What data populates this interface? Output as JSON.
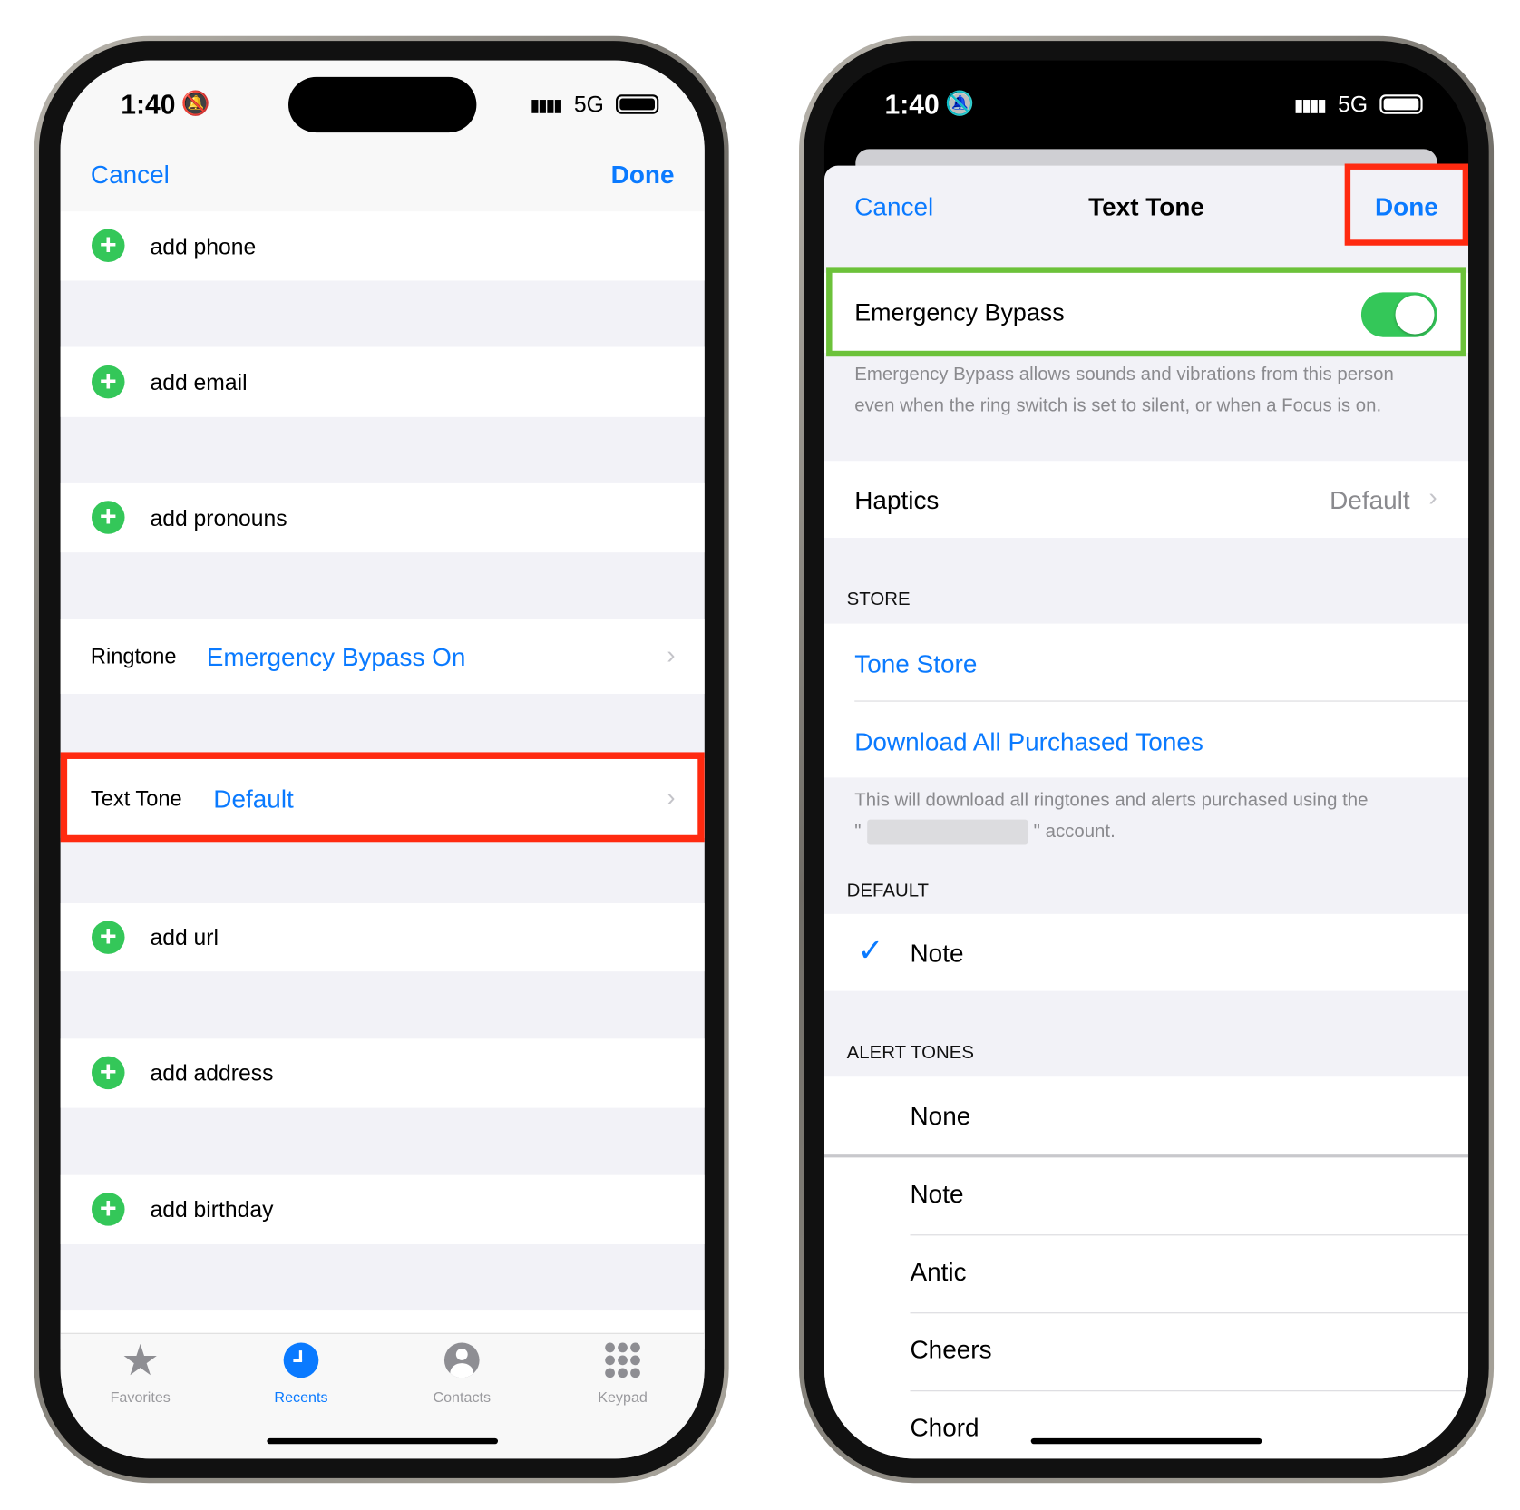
{
  "left": {
    "status": {
      "time": "1:40",
      "network": "5G"
    },
    "nav": {
      "cancel": "Cancel",
      "done": "Done"
    },
    "rows": {
      "phone": "add phone",
      "email": "add email",
      "pronouns": "add pronouns",
      "url": "add url",
      "address": "add address",
      "birthday": "add birthday"
    },
    "ringtone": {
      "label": "Ringtone",
      "value": "Emergency Bypass On"
    },
    "text_tone": {
      "label": "Text Tone",
      "value": "Default"
    },
    "tabs": [
      {
        "label": "Favorites",
        "icon": "star-icon"
      },
      {
        "label": "Recents",
        "icon": "clock-icon",
        "active": true
      },
      {
        "label": "Contacts",
        "icon": "person-circle-icon"
      },
      {
        "label": "Keypad",
        "icon": "keypad-icon"
      }
    ]
  },
  "right": {
    "status": {
      "time": "1:40",
      "network": "5G"
    },
    "nav": {
      "cancel": "Cancel",
      "title": "Text Tone",
      "done": "Done"
    },
    "emergency": {
      "label": "Emergency Bypass",
      "on": true,
      "footer": "Emergency Bypass allows sounds and vibrations from this person even when the ring switch is set to silent, or when a Focus is on."
    },
    "haptics": {
      "label": "Haptics",
      "value": "Default"
    },
    "store": {
      "header": "STORE",
      "tone_store": "Tone Store",
      "download": "Download All Purchased Tones",
      "footer_1": "This will download all ringtones and alerts purchased using the",
      "footer_2": "\" account.",
      "footer_quote": "\""
    },
    "default": {
      "header": "DEFAULT",
      "selected": "Note"
    },
    "alert_tones": {
      "header": "ALERT TONES",
      "items": [
        "None",
        "Note",
        "Antic",
        "Cheers",
        "Chord"
      ]
    }
  },
  "colors": {
    "accent": "#0a7aff",
    "highlight_red": "#ff2a10",
    "highlight_green": "#6cc23a",
    "toggle_on": "#34c759"
  }
}
